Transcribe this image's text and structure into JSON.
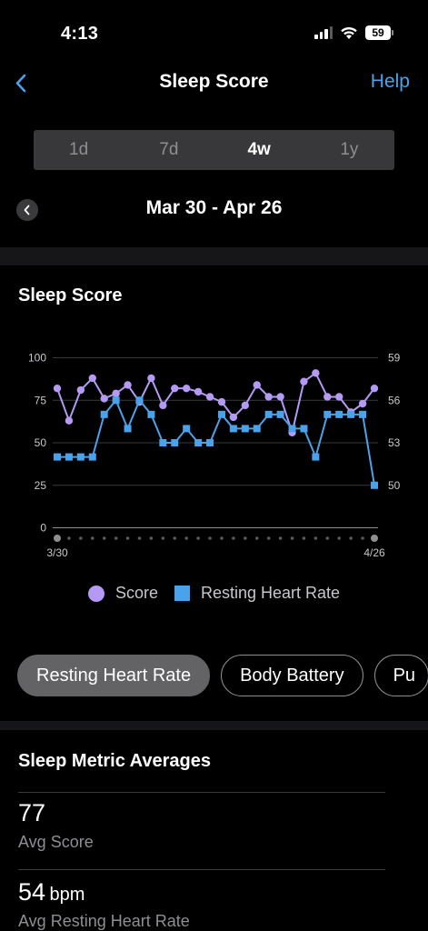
{
  "status": {
    "time": "4:13",
    "battery": "59"
  },
  "nav": {
    "title": "Sleep Score",
    "help": "Help"
  },
  "range_tabs": [
    {
      "label": "1d",
      "active": false
    },
    {
      "label": "7d",
      "active": false
    },
    {
      "label": "4w",
      "active": true
    },
    {
      "label": "1y",
      "active": false
    }
  ],
  "date_range": "Mar 30 - Apr 26",
  "chart_section": {
    "title": "Sleep Score"
  },
  "chart_data": {
    "type": "line",
    "x_start_label": "3/30",
    "x_end_label": "4/26",
    "left_axis": {
      "ticks": [
        "100",
        "75",
        "50",
        "25",
        "0"
      ],
      "min": 0,
      "max": 100
    },
    "right_axis": {
      "ticks": [
        "59",
        "56",
        "53",
        "50"
      ],
      "min": 47,
      "max": 59
    },
    "grid": true,
    "legend_position": "bottom",
    "series": [
      {
        "name": "Score",
        "marker": "circle",
        "color": "#b49af4",
        "axis": "left",
        "values": [
          82,
          63,
          81,
          88,
          76,
          79,
          84,
          74,
          88,
          72,
          82,
          82,
          80,
          77,
          74,
          65,
          72,
          84,
          77,
          77,
          56,
          86,
          91,
          77,
          77,
          68,
          73,
          82
        ]
      },
      {
        "name": "Resting Heart Rate",
        "marker": "square",
        "color": "#4aa3ea",
        "axis": "right",
        "values": [
          52,
          52,
          52,
          52,
          55,
          56,
          54,
          56,
          55,
          53,
          53,
          54,
          53,
          53,
          55,
          54,
          54,
          54,
          55,
          55,
          54,
          54,
          52,
          55,
          55,
          55,
          55,
          50
        ]
      }
    ]
  },
  "chips": [
    "Resting Heart Rate",
    "Body Battery",
    "Pu"
  ],
  "averages": {
    "title": "Sleep Metric Averages",
    "score": {
      "value": "77",
      "label": "Avg Score"
    },
    "rhr": {
      "value": "54",
      "unit": "bpm",
      "label": "Avg Resting Heart Rate"
    }
  }
}
